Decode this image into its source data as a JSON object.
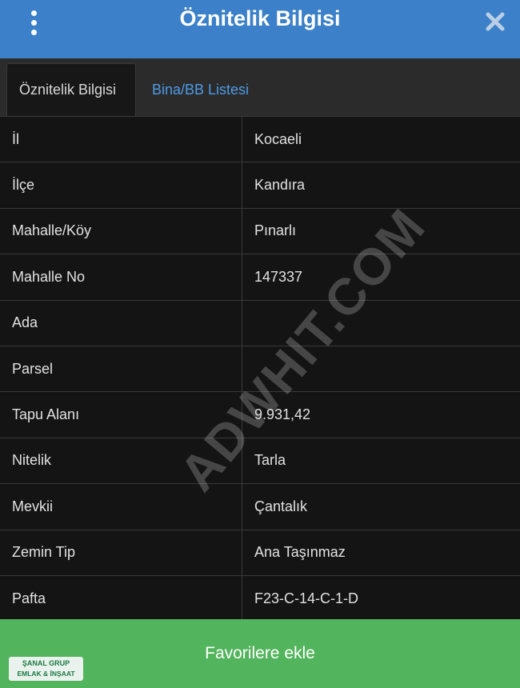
{
  "header": {
    "title": "Öznitelik Bilgisi"
  },
  "tabs": [
    {
      "label": "Öznitelik Bilgisi",
      "active": true
    },
    {
      "label": "Bina/BB Listesi",
      "active": false
    }
  ],
  "rows": [
    {
      "key": "İl",
      "value": "Kocaeli"
    },
    {
      "key": "İlçe",
      "value": "Kandıra"
    },
    {
      "key": "Mahalle/Köy",
      "value": "Pınarlı"
    },
    {
      "key": "Mahalle No",
      "value": "147337"
    },
    {
      "key": "Ada",
      "value": ""
    },
    {
      "key": "Parsel",
      "value": ""
    },
    {
      "key": "Tapu Alanı",
      "value": "9.931,42"
    },
    {
      "key": "Nitelik",
      "value": "Tarla"
    },
    {
      "key": "Mevkii",
      "value": "Çantalık"
    },
    {
      "key": "Zemin Tip",
      "value": "Ana Taşınmaz"
    },
    {
      "key": "Pafta",
      "value": "F23-C-14-C-1-D"
    }
  ],
  "watermark": "ADWHIT.COM",
  "favorite_button": {
    "label": "Favorilere ekle"
  },
  "logo": {
    "line1": "ŞANAL GRUP",
    "line2": "EMLAK & İNŞAAT"
  },
  "colors": {
    "header": "#3b80c8",
    "button": "#52b45c",
    "tab_link": "#4d9be6"
  }
}
